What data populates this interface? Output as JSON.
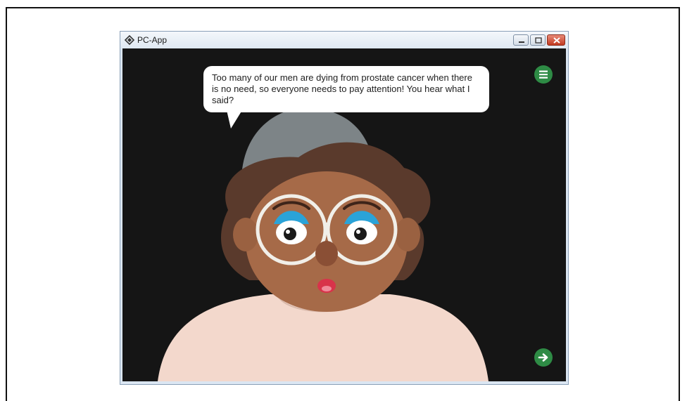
{
  "window": {
    "title": "PC-App",
    "app_icon": "app-logo-icon",
    "controls": [
      "minimize-icon",
      "maximize-icon",
      "close-icon"
    ]
  },
  "scene": {
    "speech_bubble": {
      "text": "Too many of our men are dying from prostate cancer when there is no need, so everyone needs to pay attention! You hear what I said?"
    },
    "menu_button_icon": "hamburger-menu-icon",
    "next_button_icon": "arrow-right-icon",
    "colors": {
      "background": "#151515",
      "button_green": "#2e8b45",
      "skin": "#a66a48",
      "hair": "#5a3a2c",
      "hat": "#7d8487",
      "shirt": "#f3d8cc",
      "eyeshadow": "#2aa3d8",
      "lips": "#d8334a"
    }
  }
}
